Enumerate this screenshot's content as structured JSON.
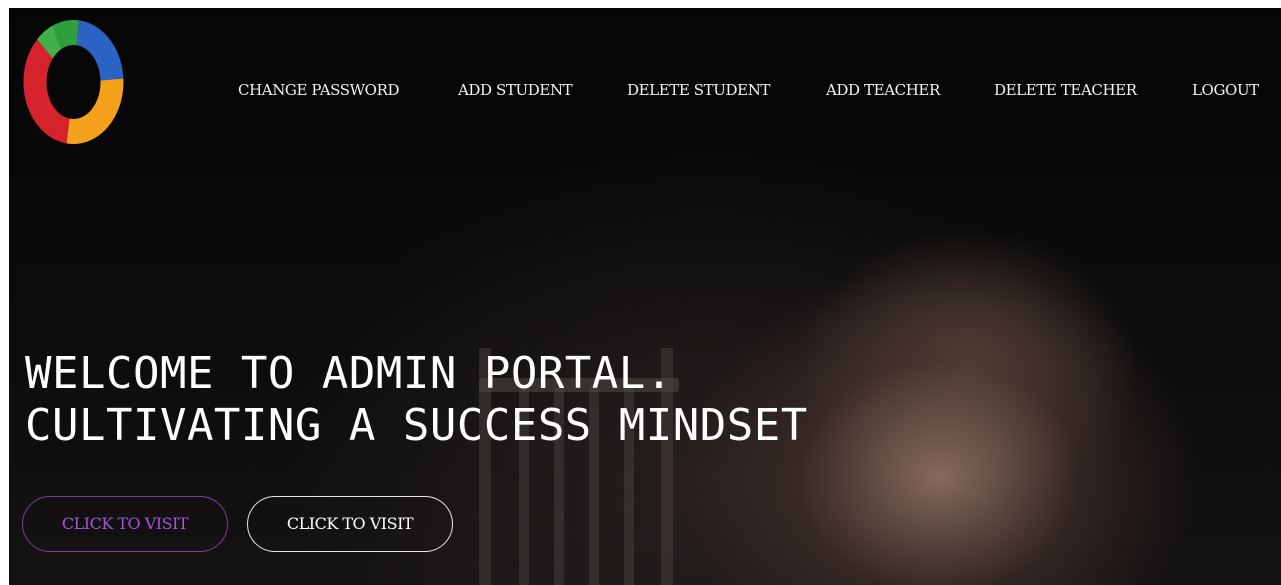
{
  "brand": {
    "logo_icon": "ring-logo-icon",
    "colors": {
      "green": "#2f9e3c",
      "blue": "#2b63c4",
      "yellow": "#f4a21c",
      "red": "#d4232b"
    }
  },
  "nav": {
    "items": [
      {
        "label": "CHANGE PASSWORD"
      },
      {
        "label": "ADD STUDENT"
      },
      {
        "label": "DELETE STUDENT"
      },
      {
        "label": "ADD TEACHER"
      },
      {
        "label": "DELETE TEACHER"
      },
      {
        "label": "LOGOUT"
      }
    ]
  },
  "hero": {
    "line1": "WELCOME TO ADMIN PORTAL.",
    "line2": "CULTIVATING A SUCCESS MINDSET",
    "primary_button": "CLICK TO VISIT",
    "secondary_button": "CLICK TO VISIT",
    "primary_color": "#a256d8"
  }
}
